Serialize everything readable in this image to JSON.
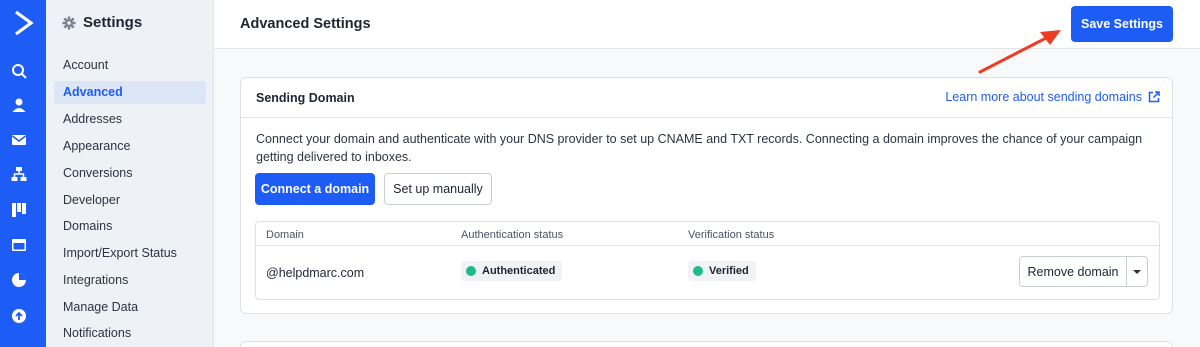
{
  "rail": {
    "logo": "activecampaign-logo",
    "icons": [
      "search-icon",
      "contacts-icon",
      "campaigns-icon",
      "automations-icon",
      "deals-icon",
      "site-icon",
      "reports-icon",
      "upgrade-icon"
    ],
    "background": "#1d5cf5"
  },
  "sidebar": {
    "title": "Settings",
    "items": [
      {
        "label": "Account"
      },
      {
        "label": "Advanced",
        "active": true
      },
      {
        "label": "Addresses"
      },
      {
        "label": "Appearance"
      },
      {
        "label": "Conversions"
      },
      {
        "label": "Developer"
      },
      {
        "label": "Domains"
      },
      {
        "label": "Import/Export Status"
      },
      {
        "label": "Integrations"
      },
      {
        "label": "Manage Data"
      },
      {
        "label": "Notifications"
      }
    ]
  },
  "header": {
    "title": "Advanced Settings",
    "save_label": "Save Settings"
  },
  "sending_domain": {
    "title": "Sending Domain",
    "learn_more": "Learn more about sending domains",
    "description": "Connect your domain and authenticate with your DNS provider to set up CNAME and TXT records. Connecting a domain improves the chance of your campaign getting delivered to inboxes.",
    "connect_label": "Connect a domain",
    "manual_label": "Set up manually",
    "table": {
      "columns": [
        "Domain",
        "Authentication status",
        "Verification status"
      ],
      "rows": [
        {
          "domain": "@helpdmarc.com",
          "auth_status": "Authenticated",
          "verify_status": "Verified",
          "action": "Remove domain"
        }
      ]
    }
  },
  "colors": {
    "accent": "#1d5cf5",
    "success": "#1dbb8a",
    "annotation_arrow": "#ee3b24"
  }
}
